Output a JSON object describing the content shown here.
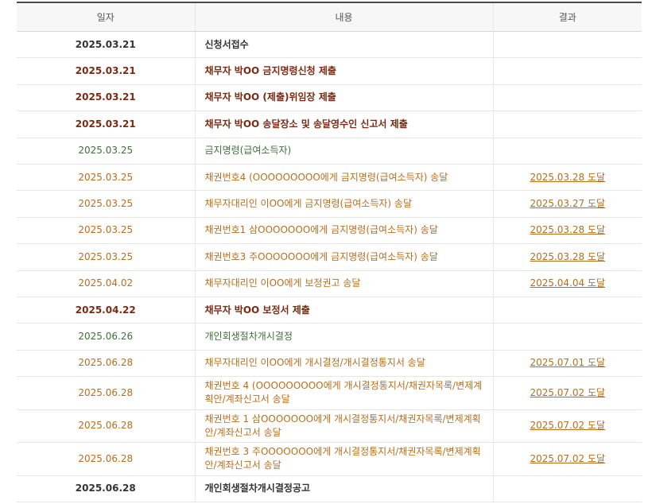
{
  "header": {
    "date": "일자",
    "content": "내용",
    "result": "결과"
  },
  "colors": {
    "dark": "#333333",
    "maroon": "#7b2a12",
    "green": "#3f6f3a",
    "orange": "#b86e1c"
  },
  "rows": [
    {
      "date": "2025.03.21",
      "content": "신청서접수",
      "result": "",
      "tone": "dark"
    },
    {
      "date": "2025.03.21",
      "content": "채무자 박OO 금지명령신청 제출",
      "result": "",
      "tone": "maroon"
    },
    {
      "date": "2025.03.21",
      "content": "채무자 박OO (제출)위임장 제출",
      "result": "",
      "tone": "maroon"
    },
    {
      "date": "2025.03.21",
      "content": "채무자 박OO 송달장소 및 송달영수인 신고서 제출",
      "result": "",
      "tone": "maroon"
    },
    {
      "date": "2025.03.25",
      "content": "금지명령(급여소득자)",
      "result": "",
      "tone": "green"
    },
    {
      "date": "2025.03.25",
      "content": "채권번호4 (OOOOOOOOO에게 금지명령(급여소득자) 송달",
      "result": "2025.03.28 도달",
      "tone": "orange"
    },
    {
      "date": "2025.03.25",
      "content": "채무자대리인 이OO에게 금지명령(급여소득자) 송달",
      "result": "2025.03.27 도달",
      "tone": "orange"
    },
    {
      "date": "2025.03.25",
      "content": "채권번호1 삼OOOOOOO에게 금지명령(급여소득자) 송달",
      "result": "2025.03.28 도달",
      "tone": "orange"
    },
    {
      "date": "2025.03.25",
      "content": "채권번호3 주OOOOOOO에게 금지명령(급여소득자) 송달",
      "result": "2025.03.28 도달",
      "tone": "orange"
    },
    {
      "date": "2025.04.02",
      "content": "채무자대리인 이OO에게 보정권고 송달",
      "result": "2025.04.04 도달",
      "tone": "orange"
    },
    {
      "date": "2025.04.22",
      "content": "채무자 박OO 보정서 제출",
      "result": "",
      "tone": "maroon"
    },
    {
      "date": "2025.06.26",
      "content": "개인회생절차개시결정",
      "result": "",
      "tone": "green"
    },
    {
      "date": "2025.06.28",
      "content": "채무자대리인 이OO에게 개시결정/개시결정통지서 송달",
      "result": "2025.07.01 도달",
      "tone": "orange"
    },
    {
      "date": "2025.06.28",
      "content": "채권번호 4 (OOOOOOOOO에게 개시결정통지서/채권자목록/변제계획안/계좌신고서 송달",
      "result": "2025.07.02 도달",
      "tone": "orange",
      "tall": true
    },
    {
      "date": "2025.06.28",
      "content": "채권번호 1 삼OOOOOOO에게 개시결정통지서/채권자목록/변제계획안/계좌신고서 송달",
      "result": "2025.07.02 도달",
      "tone": "orange",
      "tall": true
    },
    {
      "date": "2025.06.28",
      "content": "채권번호 3 주OOOOOOO에게 개시결정통지서/채권자목록/변제계획안/계좌신고서 송달",
      "result": "2025.07.02 도달",
      "tone": "orange",
      "tall": true
    },
    {
      "date": "2025.06.28",
      "content": "개인회생절차개시결정공고",
      "result": "",
      "tone": "dark"
    }
  ]
}
